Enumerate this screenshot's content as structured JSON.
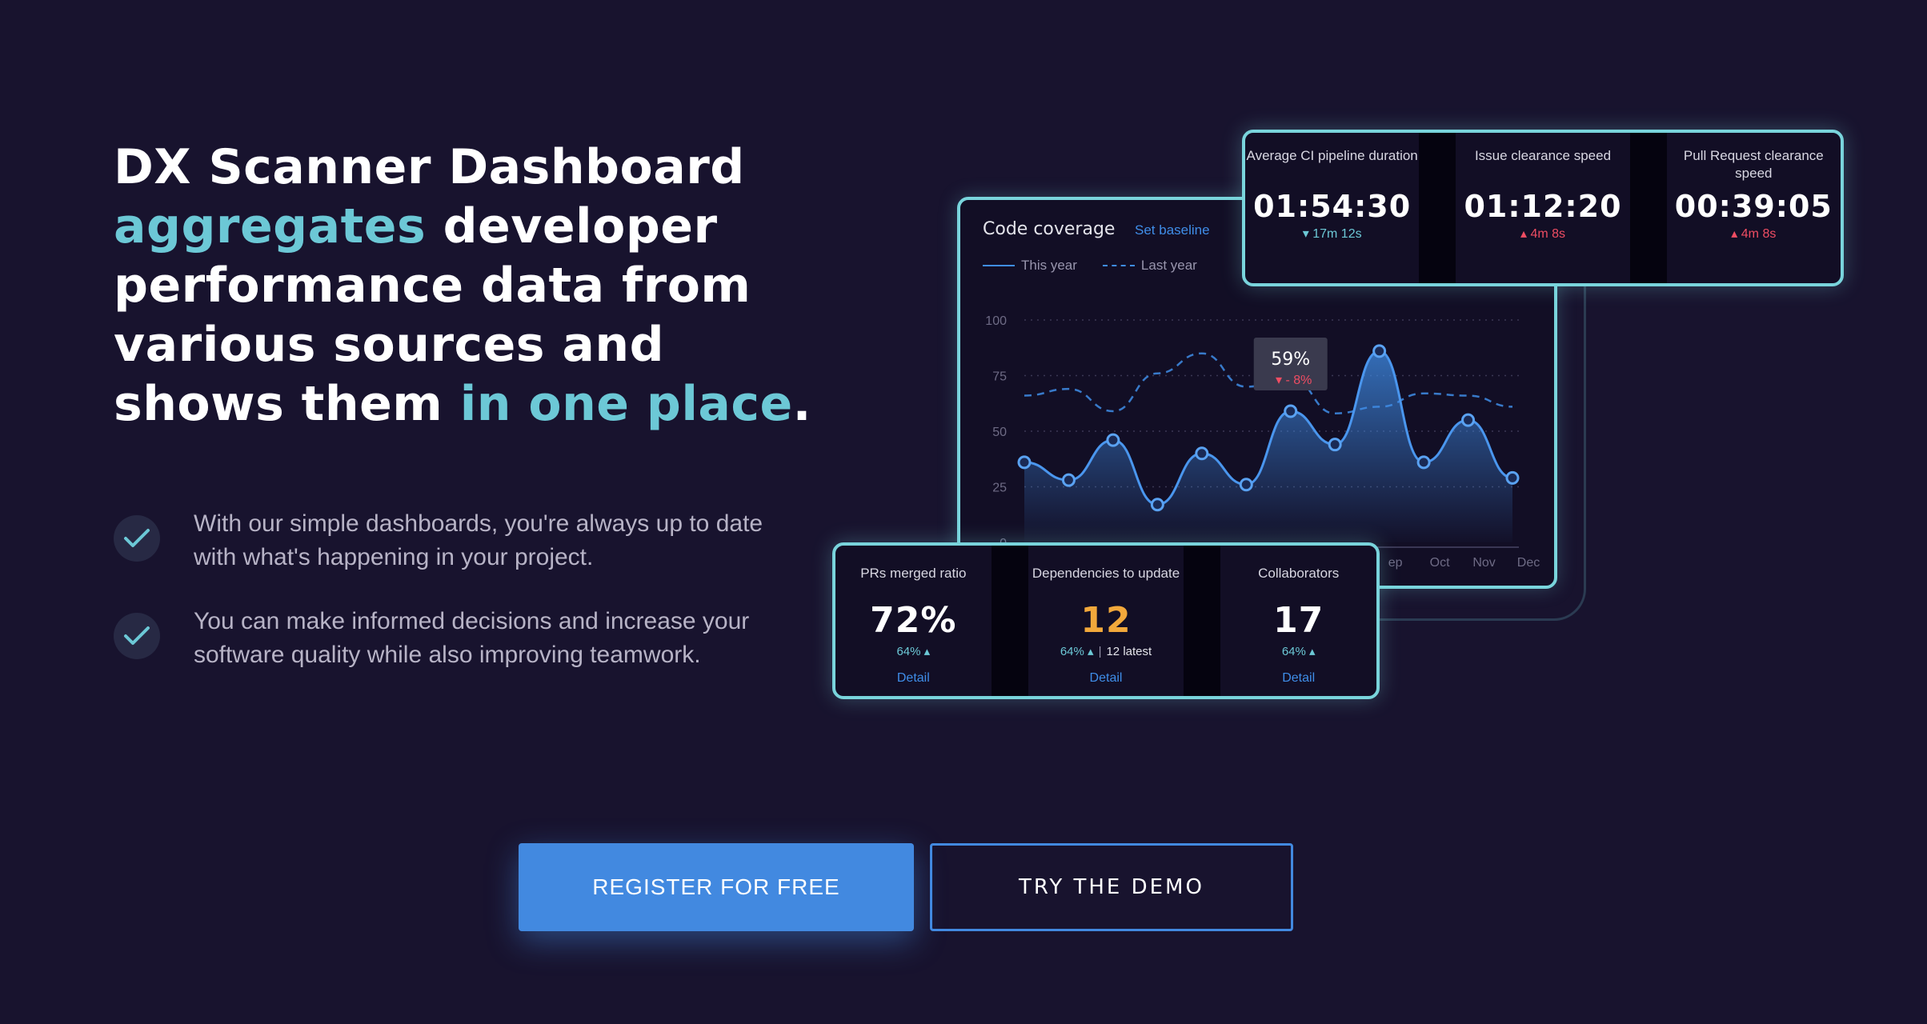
{
  "hero": {
    "line1": "DX Scanner Dashboard",
    "accent1": "aggregates",
    "line2_rest": " developer",
    "line3": "performance data from",
    "line4": "various sources and",
    "line5_start": "shows them ",
    "accent2": "in one place",
    "line5_end": "."
  },
  "bullets": [
    {
      "text": "With our simple dashboards, you're always up to date with what's happening in your project.",
      "icon": "check-icon"
    },
    {
      "text": "You can make informed decisions and increase your software quality while also improving teamwork.",
      "icon": "check-icon"
    }
  ],
  "chart_card": {
    "title": "Code coverage",
    "baseline_link": "Set baseline",
    "legend_this_year": "This year",
    "legend_last_year": "Last year",
    "tooltip_value": "59%",
    "tooltip_delta": "- 8%"
  },
  "chart_data": {
    "type": "area",
    "title": "Code coverage",
    "yticks": [
      "100",
      "75",
      "50",
      "25",
      "0"
    ],
    "ylim": [
      0,
      100
    ],
    "x_labels_visible": [
      "ep",
      "Oct",
      "Nov",
      "Dec"
    ],
    "series": [
      {
        "name": "This year",
        "style": "solid-area",
        "values": [
          36,
          28,
          46,
          17,
          40,
          26,
          59,
          44,
          86,
          36,
          55,
          29
        ]
      },
      {
        "name": "Last year",
        "style": "dashed",
        "values": [
          66,
          69,
          59,
          76,
          85,
          70,
          74,
          58,
          61,
          67,
          66,
          61
        ]
      }
    ],
    "tooltip": {
      "index": 6,
      "value": "59%",
      "delta": "- 8%"
    },
    "grid": true,
    "colors": {
      "line": "#3f8de8",
      "tooltip_bad": "#ef4d63"
    }
  },
  "stats_top": [
    {
      "label": "Average CI pipeline duration",
      "value": "01:54:30",
      "delta": "17m 12s",
      "trend": "down"
    },
    {
      "label": "Issue clearance speed",
      "value": "01:12:20",
      "delta": "4m 8s",
      "trend": "up"
    },
    {
      "label": "Pull Request clearance speed",
      "value": "00:39:05",
      "delta": "4m 8s",
      "trend": "up"
    }
  ],
  "stats_bottom": [
    {
      "label": "PRs merged ratio",
      "value": "72%",
      "sub": "64%",
      "detail": "Detail"
    },
    {
      "label": "Dependencies to update",
      "value": "12",
      "sub": "64%",
      "latest": "12 latest",
      "detail": "Detail"
    },
    {
      "label": "Collaborators",
      "value": "17",
      "sub": "64%",
      "detail": "Detail"
    }
  ],
  "buttons": {
    "register": "REGISTER FOR FREE",
    "demo": "TRY THE DEMO"
  },
  "colors": {
    "background": "#18132e",
    "accent": "#6cc8d6",
    "primary": "#4289e0",
    "card_border": "#79d4dc",
    "orange": "#f2a83b",
    "negative": "#ef4d63"
  }
}
